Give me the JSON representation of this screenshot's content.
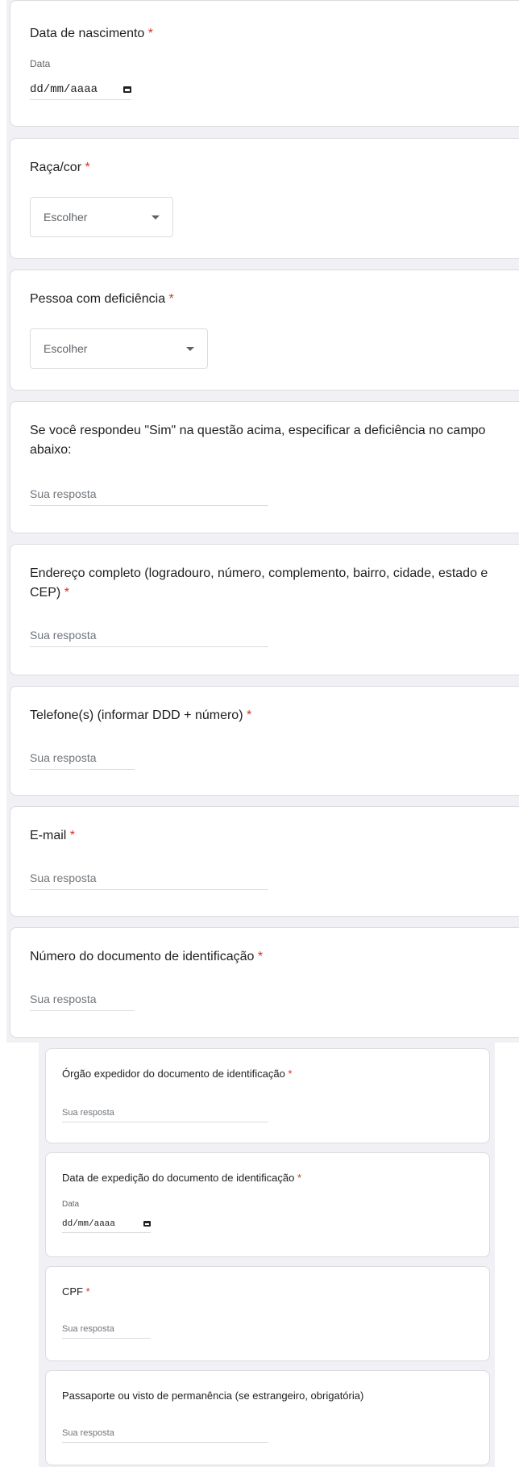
{
  "questions": {
    "birth_date": {
      "title": "Data de nascimento",
      "required_mark": "*",
      "sublabel": "Data",
      "value": "dd/mm/aaaa"
    },
    "race": {
      "title": "Raça/cor",
      "required_mark": "*",
      "selected": "Escolher"
    },
    "disability": {
      "title": "Pessoa com deficiência",
      "required_mark": "*",
      "selected": "Escolher"
    },
    "disability_detail": {
      "title_line1": "Se você respondeu \"Sim\" na questão acima, especificar a deficiência no campo",
      "title_line2": "abaixo:",
      "placeholder": "Sua resposta"
    },
    "address": {
      "title_line1": "Endereço completo (logradouro, número, complemento, bairro, cidade, estado e",
      "title_line2": "CEP)",
      "required_mark": "*",
      "placeholder": "Sua resposta"
    },
    "phone": {
      "title": "Telefone(s) (informar DDD + número)",
      "required_mark": "*",
      "placeholder": "Sua resposta"
    },
    "email": {
      "title": "E-mail",
      "required_mark": "*",
      "placeholder": "Sua resposta"
    },
    "id_number": {
      "title": "Número do documento de identificação",
      "required_mark": "*",
      "placeholder": "Sua resposta"
    },
    "id_issuer": {
      "title": "Órgão expedidor do documento de identificação",
      "required_mark": "*",
      "placeholder": "Sua resposta"
    },
    "id_issue_date": {
      "title": "Data de expedição do documento de identificação",
      "required_mark": "*",
      "sublabel": "Data",
      "value": "dd/mm/aaaa"
    },
    "cpf": {
      "title": "CPF",
      "required_mark": "*",
      "placeholder": "Sua resposta"
    },
    "passport": {
      "title": "Passaporte ou visto de permanência (se estrangeiro, obrigatória)",
      "placeholder": "Sua resposta"
    }
  },
  "colors": {
    "required": "#d93025",
    "background": "#f1f0f4",
    "border": "#dadce0"
  }
}
